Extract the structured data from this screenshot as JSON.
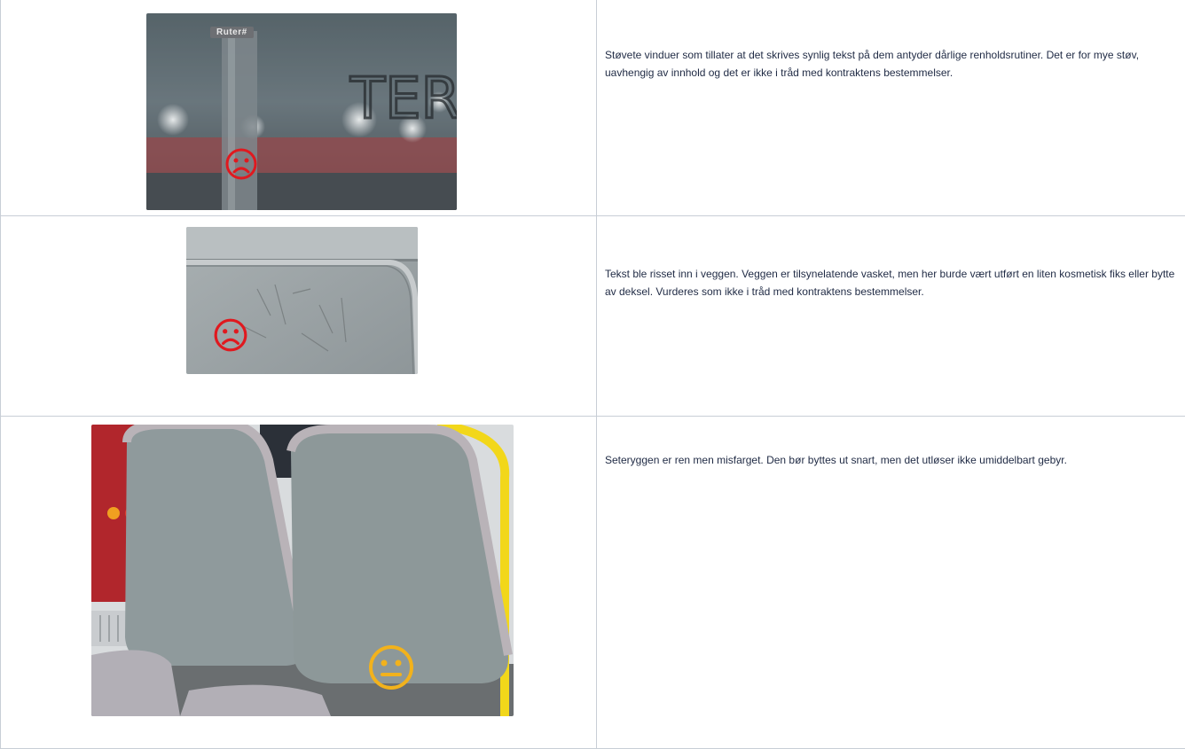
{
  "rows": [
    {
      "image_alt": "Støvete vindu med tekst skrevet i støvet",
      "plate_text": "Ruter#",
      "dust_text": "TER",
      "rating_icon": "sad-face-icon",
      "rating_color": "#e0191f",
      "description": "Støvete vinduer som tillater at det skrives synlig tekst på dem antyder dårlige renholdsrutiner. Det er for mye støv, uavhengig av innhold og det er ikke i tråd med kontraktens bestemmelser."
    },
    {
      "image_alt": "Vegg med risset tekst",
      "rating_icon": "sad-face-icon",
      "rating_color": "#e0191f",
      "description": "Tekst ble risset inn i veggen. Veggen er tilsynelatende vasket, men her burde vært utført en liten kosmetisk fiks eller bytte av deksel. Vurderes som ikke i tråd med kontraktens bestemmelser."
    },
    {
      "image_alt": "Misfarget seterygg",
      "rating_icon": "neutral-face-icon",
      "rating_color": "#f2b21c",
      "description": "Seteryggen er ren men misfarget. Den bør byttes ut snart, men det utløser ikke umiddelbart gebyr."
    }
  ]
}
